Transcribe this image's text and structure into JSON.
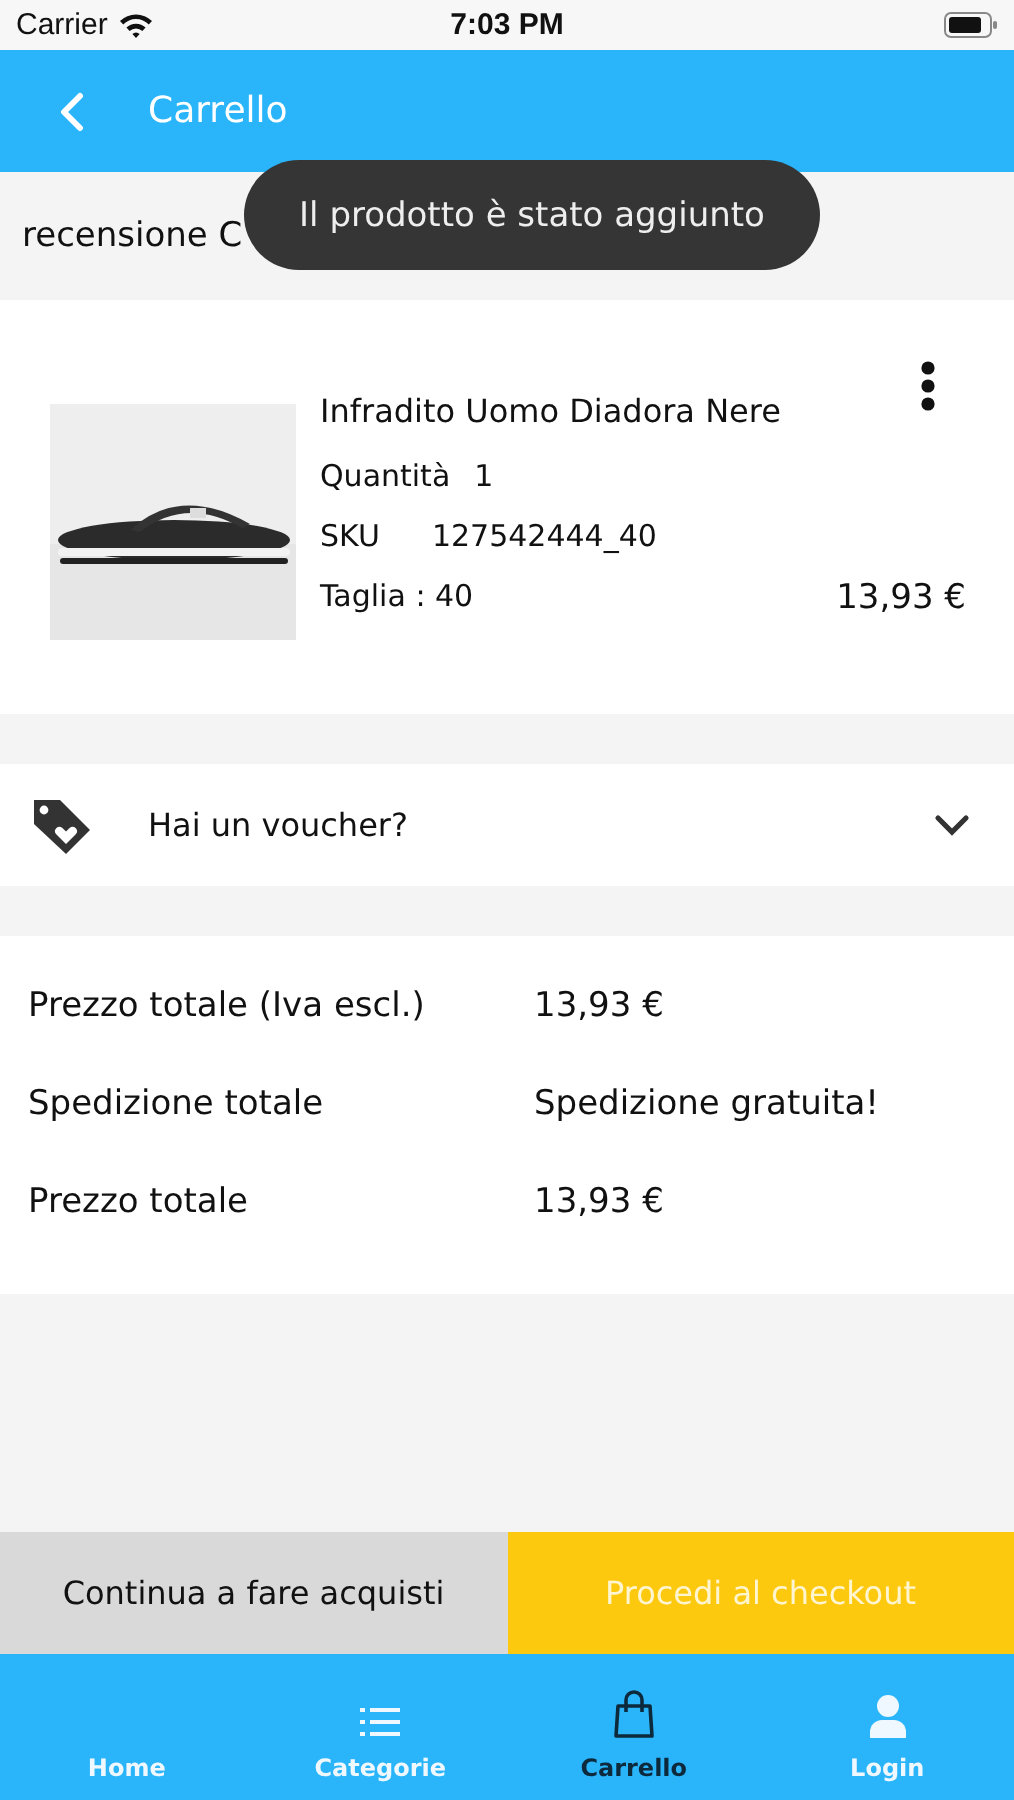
{
  "status_bar": {
    "carrier": "Carrier",
    "time": "7:03 PM"
  },
  "header": {
    "title": "Carrello"
  },
  "section_title": "recensione C",
  "toast": "Il prodotto è stato aggiunto",
  "product": {
    "kind": "picture",
    "name": "Infradito Uomo Diadora Nere",
    "quantity_label": "Quantità",
    "quantity": "1",
    "sku_label": "SKU",
    "sku": "127542444_40",
    "size": "Taglia : 40",
    "price": "13,93 €"
  },
  "voucher": {
    "label": "Hai un voucher?",
    "expanded": false
  },
  "totals": [
    {
      "label": "Prezzo totale (Iva escl.)",
      "value": "13,93 €"
    },
    {
      "label": "Spedizione totale",
      "value": "Spedizione gratuita!"
    },
    {
      "label": "Prezzo totale",
      "value": "13,93 €"
    }
  ],
  "buttons": [
    {
      "label": "Continua a fare acquisti",
      "kind": "secondary"
    },
    {
      "label": "Procedi al checkout",
      "kind": "primary"
    }
  ],
  "tab_bar": [
    {
      "label": "Home",
      "kind": "none",
      "selected": false
    },
    {
      "label": "Categorie",
      "kind": "list",
      "selected": false
    },
    {
      "label": "Carrello",
      "kind": "bag",
      "selected": true
    },
    {
      "label": "Login",
      "kind": "person",
      "selected": false
    }
  ]
}
